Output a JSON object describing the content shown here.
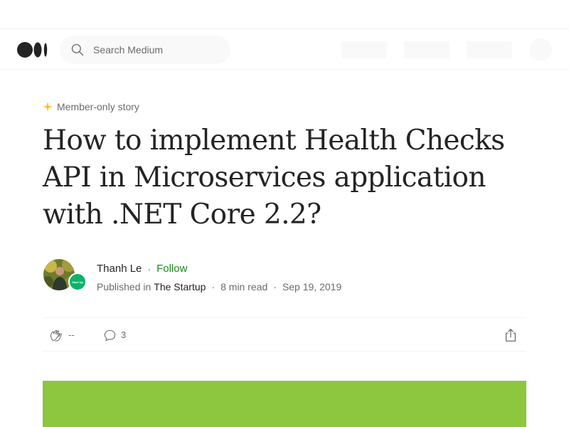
{
  "header": {
    "logo_icon": "medium-logo-icon",
    "search": {
      "placeholder": "Search Medium",
      "icon": "search-icon"
    }
  },
  "article": {
    "badge": "Member-only story",
    "badge_icon": "star-icon",
    "badge_color": "#ffc017",
    "title": "How to implement Health Checks API in Microservices application with .NET Core 2.2?",
    "author": {
      "name": "Thanh Le",
      "follow_label": "Follow",
      "follow_color": "#1a8917",
      "separator": "·"
    },
    "publication": {
      "prefix": "Published in",
      "name": "The Startup",
      "avatar_text": "Start Up",
      "avatar_color": "#0db26a"
    },
    "read_time": "8 min read",
    "date": "Sep 19, 2019",
    "actions": {
      "clap_count": "--",
      "response_count": "3",
      "clap_icon": "clap-icon",
      "response_icon": "response-icon",
      "share_icon": "share-icon"
    },
    "hero_color": "#8dc63f"
  }
}
